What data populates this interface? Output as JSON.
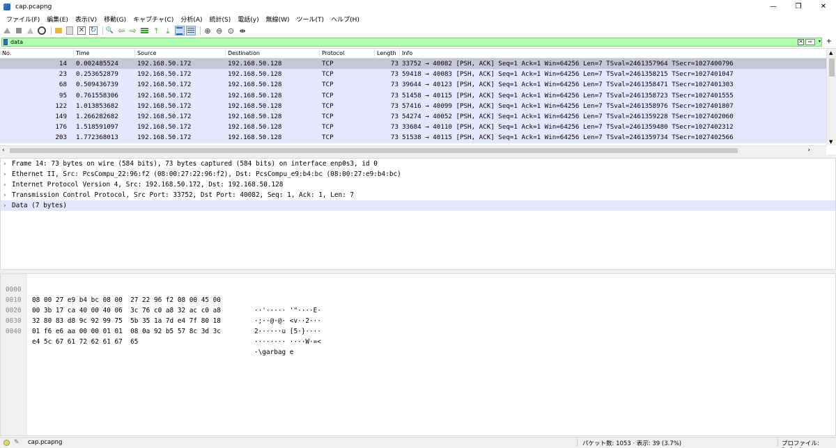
{
  "window": {
    "title": "cap.pcapng",
    "minimize": "—",
    "restore": "❐",
    "close": "✕"
  },
  "menu": [
    "ファイル(F)",
    "編集(E)",
    "表示(V)",
    "移動(G)",
    "キャプチャ(C)",
    "分析(A)",
    "統計(S)",
    "電話(y)",
    "無線(W)",
    "ツール(T)",
    "ヘルプ(H)"
  ],
  "toolbar": {
    "icons": [
      "shark-fin-icon",
      "stop-icon",
      "restart-icon",
      "options-icon",
      "open-folder-icon",
      "file-icon",
      "close-file-icon",
      "reload-icon",
      "find-icon",
      "back-icon",
      "forward-icon",
      "go-to-packet-icon",
      "first-packet-icon",
      "last-packet-icon",
      "autoscroll-icon",
      "colorize-icon",
      "zoom-in-icon",
      "zoom-out-icon",
      "zoom-reset-icon",
      "resize-columns-icon"
    ]
  },
  "filter": {
    "value": "data",
    "clear": "✕",
    "apply": "⇨",
    "dropdown": "▾",
    "add": "+",
    "background": "#afffaf"
  },
  "packet_list": {
    "columns": [
      "No.",
      "Time",
      "Source",
      "Destination",
      "Protocol",
      "Length",
      "Info"
    ],
    "rows": [
      {
        "no": "14",
        "time": "0.002485524",
        "src": "192.168.50.172",
        "dst": "192.168.50.128",
        "proto": "TCP",
        "len": "73",
        "info": "33752 → 40082 [PSH, ACK] Seq=1 Ack=1 Win=64256 Len=7 TSval=2461357964 TSecr=1027400796"
      },
      {
        "no": "23",
        "time": "0.253652879",
        "src": "192.168.50.172",
        "dst": "192.168.50.128",
        "proto": "TCP",
        "len": "73",
        "info": "59418 → 40083 [PSH, ACK] Seq=1 Ack=1 Win=64256 Len=7 TSval=2461358215 TSecr=1027401047"
      },
      {
        "no": "68",
        "time": "0.509436739",
        "src": "192.168.50.172",
        "dst": "192.168.50.128",
        "proto": "TCP",
        "len": "73",
        "info": "39644 → 40123 [PSH, ACK] Seq=1 Ack=1 Win=64256 Len=7 TSval=2461358471 TSecr=1027401303"
      },
      {
        "no": "95",
        "time": "0.761558306",
        "src": "192.168.50.172",
        "dst": "192.168.50.128",
        "proto": "TCP",
        "len": "73",
        "info": "51458 → 40115 [PSH, ACK] Seq=1 Ack=1 Win=64256 Len=7 TSval=2461358723 TSecr=1027401555"
      },
      {
        "no": "122",
        "time": "1.013853682",
        "src": "192.168.50.172",
        "dst": "192.168.50.128",
        "proto": "TCP",
        "len": "73",
        "info": "57416 → 40099 [PSH, ACK] Seq=1 Ack=1 Win=64256 Len=7 TSval=2461358976 TSecr=1027401807"
      },
      {
        "no": "149",
        "time": "1.266282682",
        "src": "192.168.50.172",
        "dst": "192.168.50.128",
        "proto": "TCP",
        "len": "73",
        "info": "54274 → 40052 [PSH, ACK] Seq=1 Ack=1 Win=64256 Len=7 TSval=2461359228 TSecr=1027402060"
      },
      {
        "no": "176",
        "time": "1.518591097",
        "src": "192.168.50.172",
        "dst": "192.168.50.128",
        "proto": "TCP",
        "len": "73",
        "info": "33684 → 40110 [PSH, ACK] Seq=1 Ack=1 Win=64256 Len=7 TSval=2461359480 TSecr=1027402312"
      },
      {
        "no": "203",
        "time": "1.772368013",
        "src": "192.168.50.172",
        "dst": "192.168.50.128",
        "proto": "TCP",
        "len": "73",
        "info": "51538 → 40115 [PSH, ACK] Seq=1 Ack=1 Win=64256 Len=7 TSval=2461359734 TSecr=1027402566"
      }
    ],
    "selected_index": 0,
    "row_color": "#e7e6ff",
    "selected_color": "#c6c6d9"
  },
  "details": {
    "expander": "›",
    "lines": [
      "Frame 14: 73 bytes on wire (584 bits), 73 bytes captured (584 bits) on interface enp0s3, id 0",
      "Ethernet II, Src: PcsCompu_22:96:f2 (08:00:27:22:96:f2), Dst: PcsCompu_e9:b4:bc (08:00:27:e9:b4:bc)",
      "Internet Protocol Version 4, Src: 192.168.50.172, Dst: 192.168.50.128",
      "Transmission Control Protocol, Src Port: 33752, Dst Port: 40082, Seq: 1, Ack: 1, Len: 7",
      "Data (7 bytes)"
    ],
    "selected_index": 4
  },
  "bytes": {
    "rows": [
      {
        "offset": "0000",
        "hex": "08 00 27 e9 b4 bc 08 00  27 22 96 f2 08 00 45 00",
        "ascii": "··'····· '\"····E·"
      },
      {
        "offset": "0010",
        "hex": "00 3b 17 ca 40 00 40 06  3c 76 c0 a8 32 ac c0 a8",
        "ascii": "·;··@·@· <v··2···"
      },
      {
        "offset": "0020",
        "hex": "32 80 83 d8 9c 92 99 75  5b 35 1a 7d e4 7f 80 18",
        "ascii": "2······u [5·}····"
      },
      {
        "offset": "0030",
        "hex": "01 f6 e6 aa 00 00 01 01  08 0a 92 b5 57 8c 3d 3c",
        "ascii": "········ ····W·=<"
      },
      {
        "offset": "0040",
        "hex": "e4 5c 67 61 72 62 61 67  65",
        "ascii": "·\\garbag e"
      }
    ]
  },
  "status": {
    "file": "cap.pcapng",
    "packets": "パケット数: 1053 · 表示: 39 (3.7%)",
    "profile": "プロファイル: Default",
    "edit_icon": "✎"
  }
}
